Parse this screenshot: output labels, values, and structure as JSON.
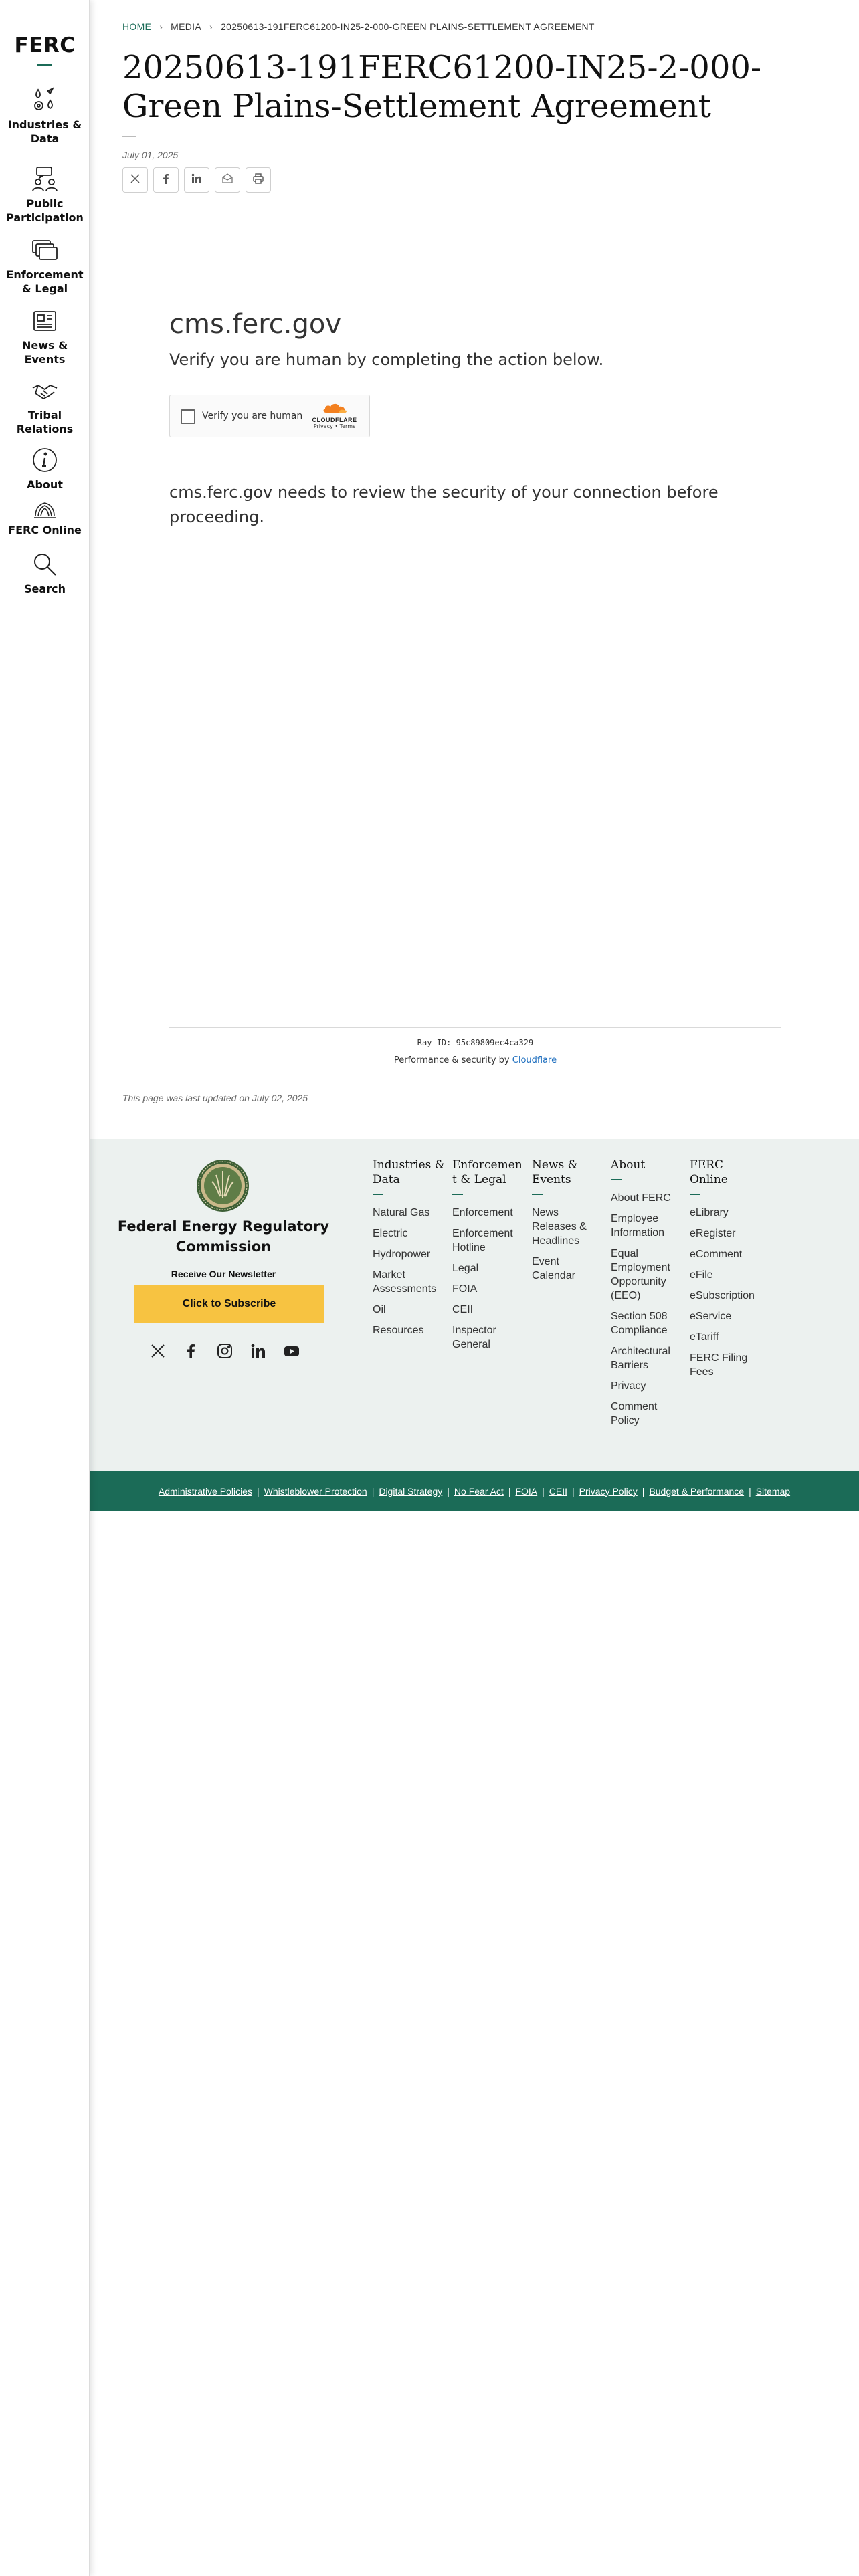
{
  "sidebar": {
    "logo": "FERC",
    "items": [
      {
        "label_line1": "Industries &",
        "label_line2": "Data",
        "icon": "industries-icon"
      },
      {
        "label_line1": "Public",
        "label_line2": "Participation",
        "icon": "people-chat-icon"
      },
      {
        "label_line1": "Enforcement",
        "label_line2": "& Legal",
        "icon": "documents-icon"
      },
      {
        "label_line1": "News &",
        "label_line2": "Events",
        "icon": "newspaper-icon"
      },
      {
        "label_line1": "Tribal",
        "label_line2": "Relations",
        "icon": "handshake-icon"
      },
      {
        "label_line1": "About",
        "label_line2": "",
        "icon": "info-icon"
      },
      {
        "label_line1": "FERC Online",
        "label_line2": "",
        "icon": "ferc-online-icon"
      },
      {
        "label_line1": "Search",
        "label_line2": "",
        "icon": "search-icon"
      }
    ]
  },
  "breadcrumb": {
    "home": "HOME",
    "media": "MEDIA",
    "current": "20250613-191FERC61200-IN25-2-000-GREEN PLAINS-SETTLEMENT AGREEMENT"
  },
  "page": {
    "title": "20250613-191FERC61200-IN25-2-000-Green Plains-Settlement Agreement",
    "date": "July 01, 2025",
    "last_updated": "This page was last updated on July 02, 2025"
  },
  "share": [
    "x-icon",
    "facebook-icon",
    "linkedin-icon",
    "email-icon",
    "print-icon"
  ],
  "challenge": {
    "domain": "cms.ferc.gov",
    "verify_text": "Verify you are human by completing the action below.",
    "checkbox_label": "Verify you are human",
    "brand": "CLOUDFLARE",
    "privacy": "Privacy",
    "terms": "Terms",
    "security_message": "cms.ferc.gov needs to review the security of your connection before proceeding.",
    "ray_id": "Ray ID: 95c89809ec4ca329",
    "perf_prefix": "Performance & security by",
    "perf_link": "Cloudflare"
  },
  "footer": {
    "org_name": "Federal Energy Regulatory Commission",
    "newsletter_label": "Receive Our Newsletter",
    "subscribe": "Click to Subscribe",
    "social": [
      "x-icon",
      "facebook-icon",
      "instagram-icon",
      "linkedin-icon",
      "youtube-icon"
    ],
    "columns": [
      {
        "title": "Industries & Data",
        "links": [
          "Natural Gas",
          "Electric",
          "Hydropower",
          "Market Assessments",
          "Oil",
          "Resources"
        ]
      },
      {
        "title": "Enforcement & Legal",
        "links": [
          "Enforcement",
          "Enforcement Hotline",
          "Legal",
          "FOIA",
          "CEII",
          "Inspector General"
        ]
      },
      {
        "title": "News & Events",
        "links": [
          "News Releases & Headlines",
          "Event Calendar"
        ]
      },
      {
        "title": "About",
        "links": [
          "About FERC",
          "Employee Information",
          "Equal Employment Opportunity (EEO)",
          "Section 508 Compliance",
          "Architectural Barriers",
          "Privacy",
          "Comment Policy"
        ]
      },
      {
        "title": "FERC Online",
        "links": [
          "eLibrary",
          "eRegister",
          "eComment",
          "eFile",
          "eSubscription",
          "eService",
          "eTariff",
          "FERC Filing Fees"
        ]
      }
    ],
    "bottom_links": [
      "Administrative Policies",
      "Whistleblower Protection",
      "Digital Strategy",
      "No Fear Act",
      "FOIA",
      "CEII",
      "Privacy Policy",
      "Budget & Performance",
      "Sitemap"
    ]
  },
  "colors": {
    "accent": "#1b6b57",
    "subscribe": "#f7c341",
    "footer_bg": "#ecf1ef",
    "link_blue": "#1f6fbf"
  }
}
